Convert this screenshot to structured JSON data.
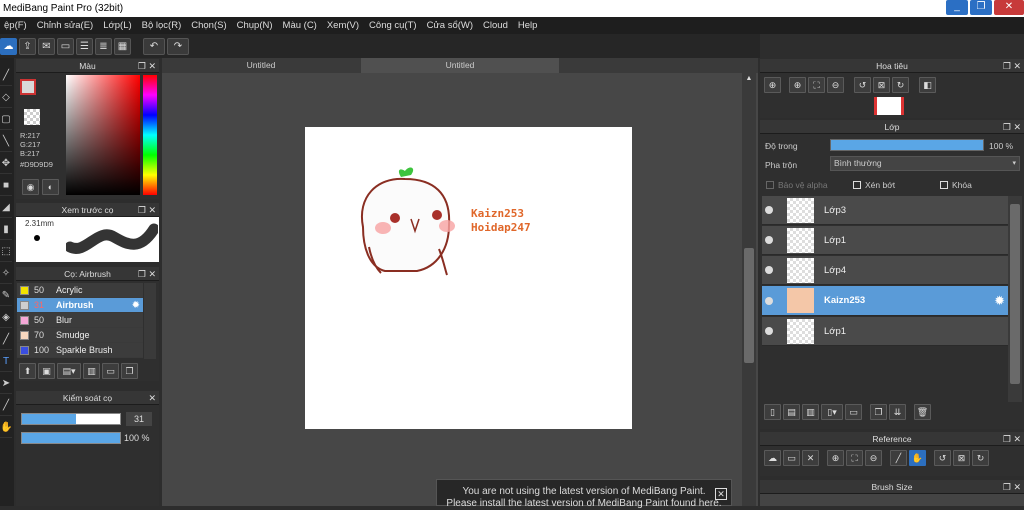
{
  "window": {
    "title": "MediBang Paint Pro (32bit)",
    "controls": [
      "_",
      "❐",
      "✕"
    ]
  },
  "menu": [
    "ệp(F)",
    "Chỉnh sửa(E)",
    "Lớp(L)",
    "Bộ lọc(R)",
    "Chọn(S)",
    "Chụp(N)",
    "Màu (C)",
    "Xem(V)",
    "Công cụ(T)",
    "Cửa sổ(W)",
    "Cloud",
    "Help"
  ],
  "tabs": [
    "Untitled",
    "Untitled"
  ],
  "color_panel": {
    "title": "Màu",
    "r": "R:217",
    "g": "G:217",
    "b": "B:217",
    "hex": "#D9D9D9",
    "current_color": "#d9d9d9"
  },
  "preview_panel": {
    "title": "Xem trước cọ",
    "size": "2.31mm"
  },
  "brush_panel": {
    "title": "Cọ: Airbrush",
    "items": [
      {
        "size": "50",
        "name": "Acrylic",
        "color": "#f2e200"
      },
      {
        "size": "31",
        "name": "Airbrush",
        "color": "#cfcfcf"
      },
      {
        "size": "50",
        "name": "Blur",
        "color": "#f5a8d8"
      },
      {
        "size": "70",
        "name": "Smudge",
        "color": "#f7d8c0"
      },
      {
        "size": "100",
        "name": "Sparkle Brush",
        "color": "#3a4ee0"
      }
    ]
  },
  "brush_control": {
    "title": "Kiểm soát cọ",
    "size_value": "31",
    "opacity_value": "100 %",
    "size_fraction": 0.55,
    "opacity_fraction": 1.0
  },
  "navigator": {
    "title": "Hoa tiêu"
  },
  "layer_panel": {
    "title": "Lớp",
    "opacity_label": "Độ trong",
    "opacity_value": "100 %",
    "opacity_fraction": 1.0,
    "blend_label": "Pha trộn",
    "blend_value": "Bình thường",
    "protect_alpha": "Bảo vệ alpha",
    "clip": "Xén bớt",
    "lock": "Khóa",
    "layers": [
      {
        "name": "Lớp3",
        "selected": false
      },
      {
        "name": "Lớp1",
        "selected": false
      },
      {
        "name": "Lớp4",
        "selected": false
      },
      {
        "name": "Kaizn253",
        "selected": true
      },
      {
        "name": "Lớp1",
        "selected": false
      }
    ]
  },
  "reference_panel": {
    "title": "Reference"
  },
  "brush_size_panel": {
    "title": "Brush Size"
  },
  "canvas_text": {
    "line1": "Kaizn253",
    "line2": "Hoidap247"
  },
  "notice": {
    "line1": "You are not using the latest version of MediBang Paint.",
    "line2": "Please install the latest version of MediBang Paint found here."
  }
}
